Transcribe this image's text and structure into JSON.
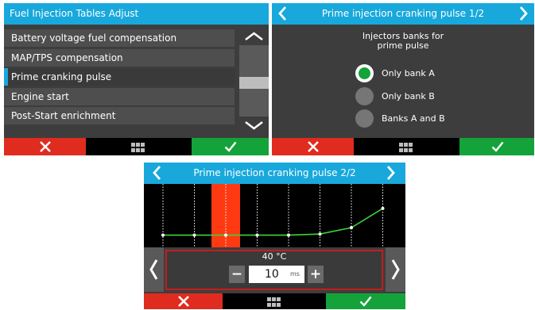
{
  "colors": {
    "title_blue": "#18a8dc",
    "cancel_red": "#e02b1f",
    "confirm_green": "#14a33a",
    "panel_bg": "#3d3d3d",
    "selection_accent": "#18a8dc"
  },
  "icons": {
    "back": "chevron-left-icon",
    "forward": "chevron-right-icon",
    "cancel": "x-icon",
    "confirm": "checkmark-icon",
    "menu": "grid-icon",
    "scroll_up": "chevron-up-icon",
    "scroll_down": "chevron-down-icon"
  },
  "menu_screen": {
    "title": "Fuel Injection Tables Adjust",
    "items": [
      {
        "label": "Battery voltage fuel compensation"
      },
      {
        "label": "MAP/TPS compensation"
      },
      {
        "label": "Prime cranking pulse",
        "selected": true
      },
      {
        "label": "Engine start"
      },
      {
        "label": "Post-Start enrichment"
      }
    ]
  },
  "bank_screen": {
    "title": "Prime injection cranking pulse 1/2",
    "subtitle_line1": "Injectors banks for",
    "subtitle_line2": "prime pulse",
    "options": [
      {
        "label": "Only bank A",
        "checked": true
      },
      {
        "label": "Only bank B",
        "checked": false
      },
      {
        "label": "Banks A and B",
        "checked": false
      }
    ]
  },
  "pulse_screen": {
    "title": "Prime injection cranking pulse 2/2",
    "temperature": "40 °C",
    "value": "10",
    "unit": "ms",
    "minus_label": "−",
    "plus_label": "+",
    "selected_point_index": 2
  },
  "chart_data": {
    "type": "line",
    "x": [
      0,
      1,
      2,
      3,
      4,
      5,
      6,
      7
    ],
    "series": [
      {
        "values": [
          10,
          10,
          10,
          10,
          10,
          11,
          17,
          35
        ]
      }
    ],
    "ylim": [
      0,
      55
    ],
    "grid": true,
    "highlighted_index": 2
  }
}
